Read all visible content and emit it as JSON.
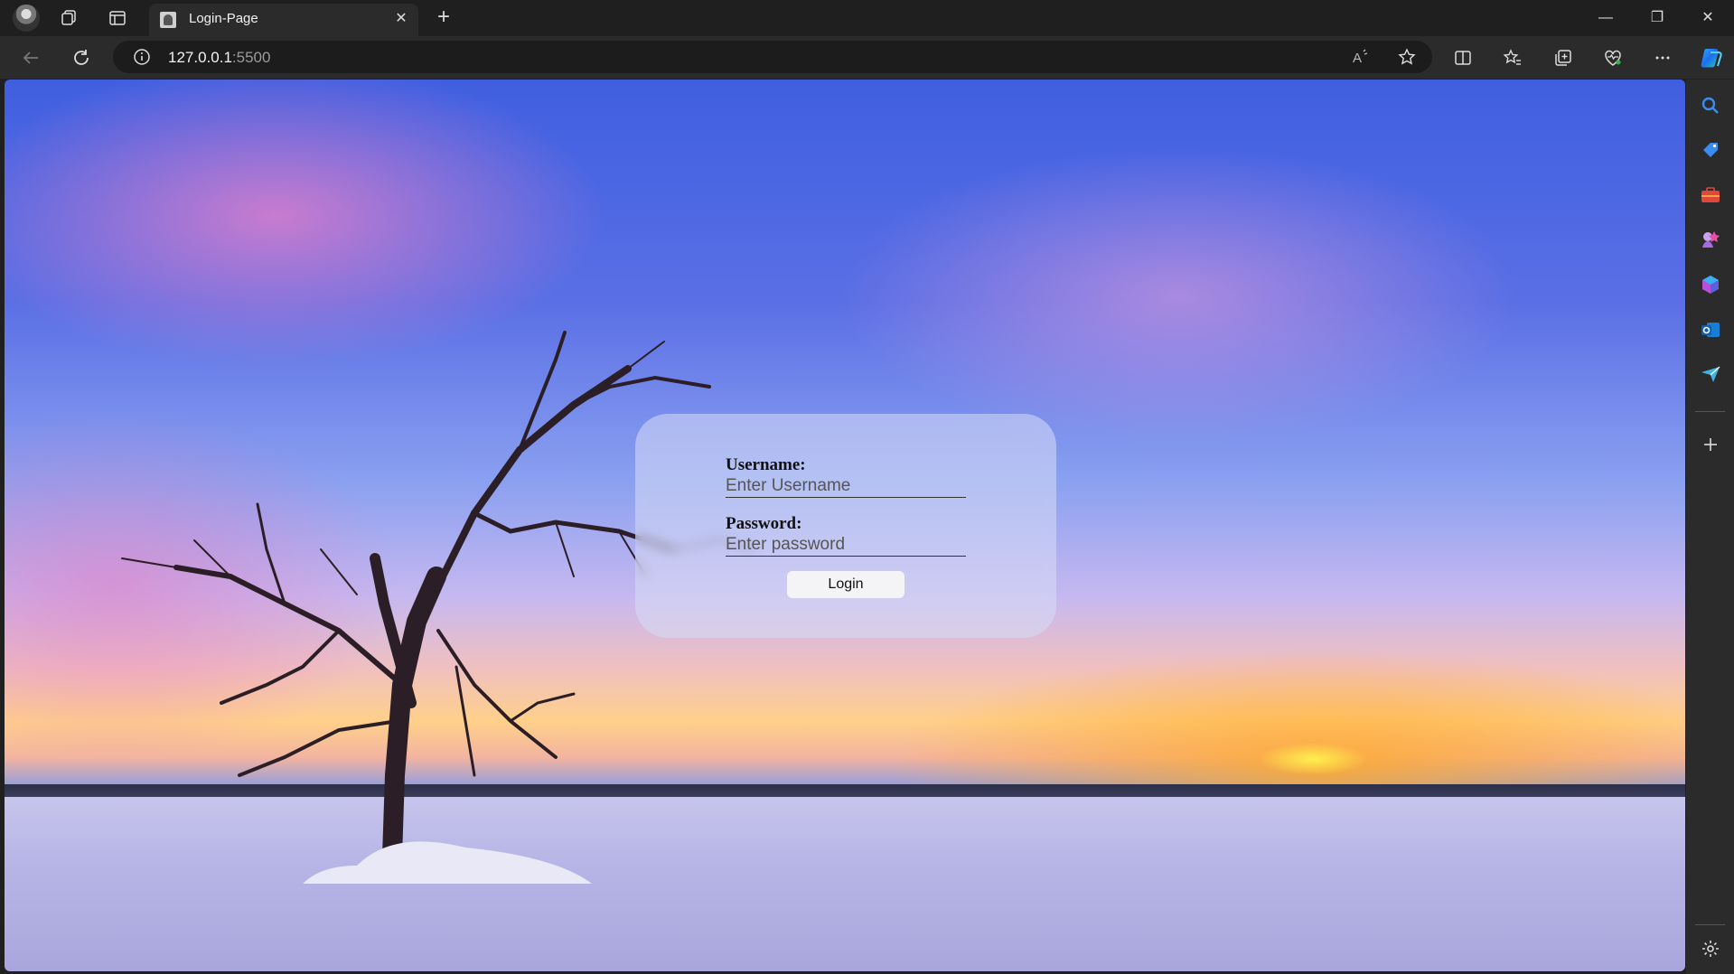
{
  "tab": {
    "title": "Login-Page",
    "close": "✕"
  },
  "browser": {
    "new_tab": "+",
    "url_host": "127.0.0.1",
    "url_port": ":5500",
    "window_controls": {
      "minimize": "—",
      "restore": "❐",
      "close": "✕"
    }
  },
  "login": {
    "username_label": "Username:",
    "username_placeholder": "Enter Username",
    "password_label": "Password:",
    "password_placeholder": "Enter password",
    "submit_label": "Login"
  },
  "colors": {
    "chrome_bg": "#1f1f1f",
    "toolbar_bg": "#2b2b2b",
    "card_bg": "rgba(215,220,245,.55)"
  },
  "icons": {
    "toolbar": [
      "back-icon",
      "refresh-icon",
      "site-info-icon",
      "read-aloud-icon",
      "favorite-star-icon",
      "split-screen-icon",
      "favorites-icon",
      "collections-icon",
      "browser-essentials-icon",
      "more-icon",
      "copilot-icon"
    ],
    "sidebar": [
      "search-icon",
      "shopping-icon",
      "tools-icon",
      "games-icon",
      "microsoft-365-icon",
      "outlook-icon",
      "drop-icon",
      "add-icon",
      "settings-icon"
    ]
  }
}
